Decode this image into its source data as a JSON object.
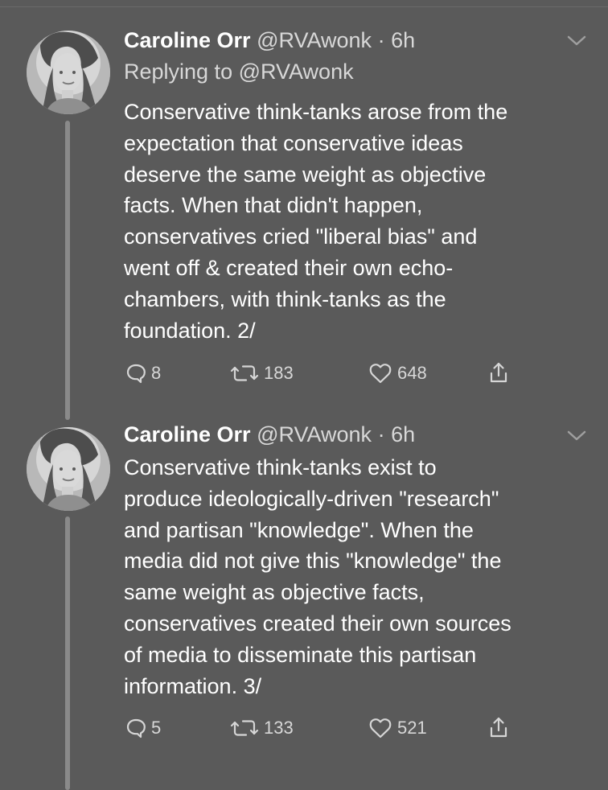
{
  "tweets": [
    {
      "author": {
        "name": "Caroline Orr",
        "handle": "@RVAwonk",
        "dot": "·",
        "time": "6h"
      },
      "reply_prefix": "Replying to",
      "reply_to": "@RVAwonk",
      "text": "Conservative think-tanks arose from the\nexpectation that conservative ideas\ndeserve the same weight as objective\nfacts.  When that didn't happen,\nconservatives cried \"liberal bias\" and\nwent off & created their own echo-\nchambers, with think-tanks as the\nfoundation. 2/",
      "stats": {
        "replies": "8",
        "retweets": "183",
        "likes": "648"
      },
      "icons": {
        "avatar": "avatar-icon",
        "chevron": "chevron-down-icon",
        "reply": "reply-icon",
        "retweet": "retweet-icon",
        "like": "heart-icon",
        "share": "share-icon"
      }
    },
    {
      "author": {
        "name": "Caroline Orr",
        "handle": "@RVAwonk",
        "dot": "·",
        "time": "6h"
      },
      "text": "Conservative think-tanks exist to\nproduce ideologically-driven \"research\"\nand partisan \"knowledge\". When the\nmedia did not give this \"knowledge\" the\nsame weight as objective facts,\nconservatives created their own sources\nof media to disseminate this partisan\ninformation. 3/",
      "stats": {
        "replies": "5",
        "retweets": "133",
        "likes": "521"
      },
      "icons": {
        "avatar": "avatar-icon",
        "chevron": "chevron-down-icon",
        "reply": "reply-icon",
        "retweet": "retweet-icon",
        "like": "heart-icon",
        "share": "share-icon"
      }
    }
  ],
  "colors": {
    "background": "#5a5a5a",
    "text": "#ffffff",
    "muted": "#d8d8d8",
    "thread_line": "#8a8a8a"
  }
}
